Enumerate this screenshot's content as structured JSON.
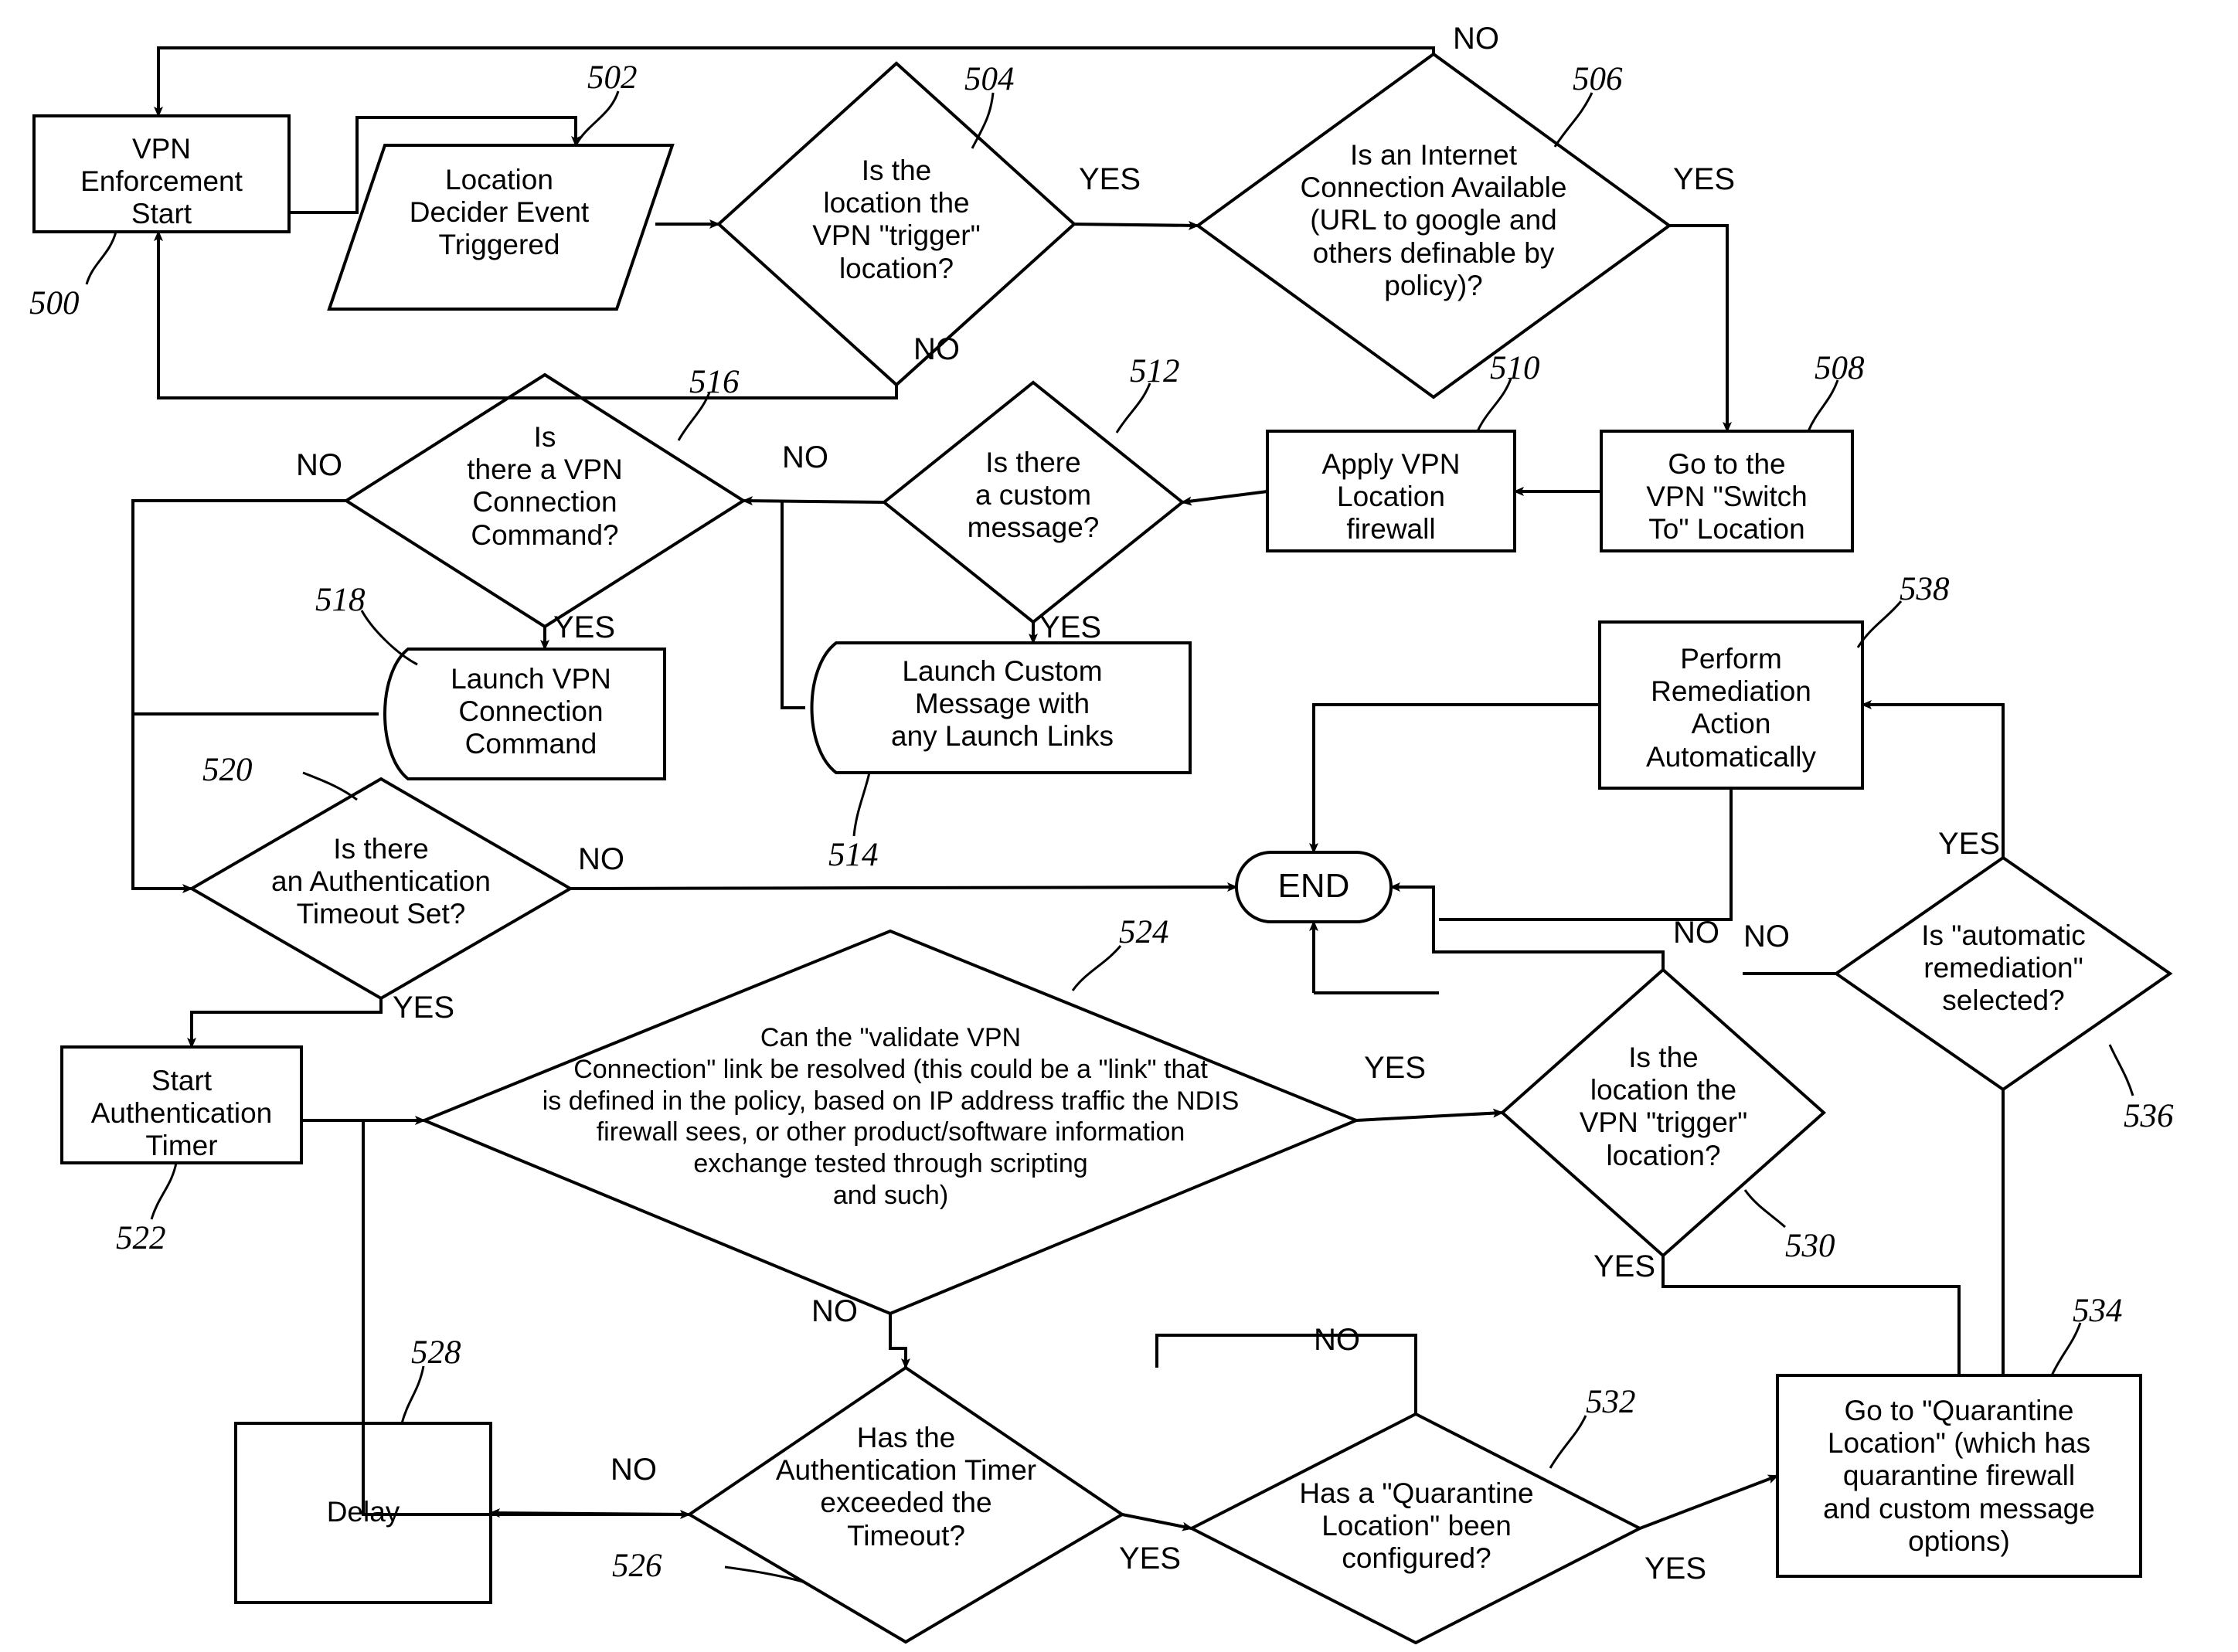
{
  "figure": {
    "kind": "patent-flowchart",
    "title": "VPN Enforcement flow"
  },
  "nodes": [
    {
      "id": "n500",
      "ref": "500",
      "shape": "process",
      "label": "VPN\nEnforcement\nStart"
    },
    {
      "id": "n502",
      "ref": "502",
      "shape": "parallelogram",
      "label": "Location\nDecider Event\nTriggered"
    },
    {
      "id": "n504",
      "ref": "504",
      "shape": "decision",
      "label": "Is the\nlocation the\nVPN \"trigger\"\nlocation?"
    },
    {
      "id": "n506",
      "ref": "506",
      "shape": "decision",
      "label": "Is an Internet\nConnection Available\n(URL to google and\nothers definable by\npolicy)?"
    },
    {
      "id": "n508",
      "ref": "508",
      "shape": "process",
      "label": "Go to the\nVPN \"Switch\nTo\" Location"
    },
    {
      "id": "n510",
      "ref": "510",
      "shape": "process",
      "label": "Apply VPN\nLocation\nfirewall"
    },
    {
      "id": "n512",
      "ref": "512",
      "shape": "decision",
      "label": "Is there\na custom\nmessage?"
    },
    {
      "id": "n514",
      "ref": "514",
      "shape": "display",
      "label": "Launch Custom\nMessage with\nany Launch Links"
    },
    {
      "id": "n516",
      "ref": "516",
      "shape": "decision",
      "label": "Is\nthere a VPN\nConnection\nCommand?"
    },
    {
      "id": "n518",
      "ref": "518",
      "shape": "display",
      "label": "Launch VPN\nConnection\nCommand"
    },
    {
      "id": "n520",
      "ref": "520",
      "shape": "decision",
      "label": "Is there\nan Authentication\nTimeout Set?"
    },
    {
      "id": "n522",
      "ref": "522",
      "shape": "process",
      "label": "Start\nAuthentication\nTimer"
    },
    {
      "id": "n524",
      "ref": "524",
      "shape": "decision",
      "label": "Can the \"validate VPN\nConnection\" link be resolved (this could be a \"link\" that\nis defined in the policy, based on IP address traffic the NDIS\nfirewall sees, or other product/software information\nexchange tested through scripting\nand such)"
    },
    {
      "id": "n526",
      "ref": "526",
      "shape": "decision",
      "label": "Has the\nAuthentication Timer\nexceeded the\nTimeout?"
    },
    {
      "id": "n528",
      "ref": "528",
      "shape": "process",
      "label": "Delay"
    },
    {
      "id": "n530",
      "ref": "530",
      "shape": "decision",
      "label": "Is the\nlocation the\nVPN \"trigger\"\nlocation?"
    },
    {
      "id": "n532",
      "ref": "532",
      "shape": "decision",
      "label": "Has a \"Quarantine\nLocation\" been\nconfigured?"
    },
    {
      "id": "n534",
      "ref": "534",
      "shape": "process",
      "label": "Go to \"Quarantine\nLocation\" (which has\nquarantine firewall\nand custom message\noptions)"
    },
    {
      "id": "n536",
      "ref": "536",
      "shape": "decision",
      "label": "Is \"automatic\nremediation\"\nselected?"
    },
    {
      "id": "n538",
      "ref": "538",
      "shape": "process",
      "label": "Perform\nRemediation\nAction\nAutomatically"
    },
    {
      "id": "nend",
      "ref": "",
      "shape": "terminator",
      "label": "END"
    }
  ],
  "edge_labels": [
    {
      "id": "e1",
      "text": "YES",
      "for": "504-yes"
    },
    {
      "id": "e2",
      "text": "NO",
      "for": "504-no"
    },
    {
      "id": "e3",
      "text": "NO",
      "for": "506-no"
    },
    {
      "id": "e4",
      "text": "YES",
      "for": "506-yes"
    },
    {
      "id": "e5",
      "text": "NO",
      "for": "512-no"
    },
    {
      "id": "e6",
      "text": "YES",
      "for": "512-yes"
    },
    {
      "id": "e7",
      "text": "NO",
      "for": "516-no"
    },
    {
      "id": "e8",
      "text": "YES",
      "for": "516-yes"
    },
    {
      "id": "e9",
      "text": "NO",
      "for": "520-no"
    },
    {
      "id": "e10",
      "text": "YES",
      "for": "520-yes"
    },
    {
      "id": "e11",
      "text": "YES",
      "for": "524-yes"
    },
    {
      "id": "e12",
      "text": "NO",
      "for": "524-no"
    },
    {
      "id": "e13",
      "text": "NO",
      "for": "526-no"
    },
    {
      "id": "e14",
      "text": "YES",
      "for": "526-yes"
    },
    {
      "id": "e15",
      "text": "NO",
      "for": "530-no"
    },
    {
      "id": "e16",
      "text": "YES",
      "for": "530-yes"
    },
    {
      "id": "e17",
      "text": "NO",
      "for": "532-no"
    },
    {
      "id": "e18",
      "text": "YES",
      "for": "532-yes"
    },
    {
      "id": "e19",
      "text": "NO",
      "for": "536-no"
    },
    {
      "id": "e20",
      "text": "YES",
      "for": "536-yes"
    }
  ],
  "ref_numbers": [
    "500",
    "502",
    "504",
    "506",
    "508",
    "510",
    "512",
    "514",
    "516",
    "518",
    "520",
    "522",
    "524",
    "526",
    "528",
    "530",
    "532",
    "534",
    "536",
    "538"
  ]
}
